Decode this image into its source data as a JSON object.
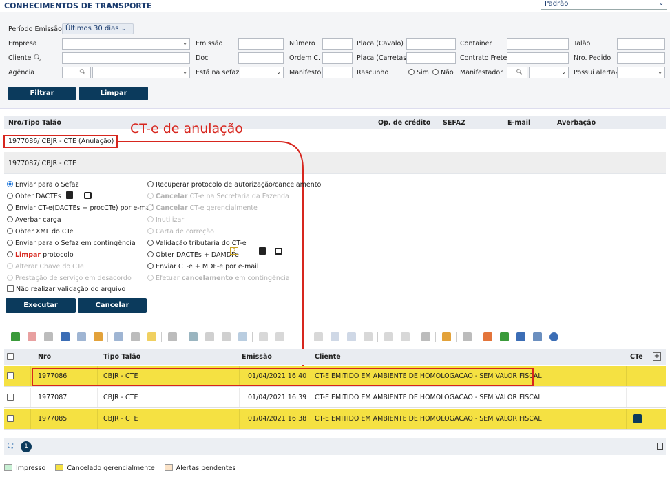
{
  "header": {
    "title": "CONHECIMENTOS DE TRANSPORTE",
    "preset": "Padrão"
  },
  "filters": {
    "periodo_label": "Período Emissão",
    "periodo_value": "Últimos 30 dias",
    "labels": {
      "empresa": "Empresa",
      "emissao": "Emissão",
      "numero": "Número",
      "placa_cavalo": "Placa (Cavalo)",
      "container": "Container",
      "talao": "Talão",
      "cliente": "Cliente",
      "doc": "Doc",
      "ordem": "Ordem C.",
      "placa_carretas": "Placa (Carretas)",
      "contrato": "Contrato Frete",
      "nro_pedido": "Nro. Pedido",
      "agencia": "Agência",
      "sefaz": "Está na sefaz?",
      "manifesto": "Manifesto",
      "rascunho": "Rascunho",
      "sim": "Sim",
      "nao": "Não",
      "manifestador": "Manifestador",
      "alerta": "Possui alerta?"
    },
    "filtrar": "Filtrar",
    "limpar": "Limpar"
  },
  "talao_table": {
    "headers": [
      "Nro/Tipo Talão",
      "Op. de crédito",
      "SEFAZ",
      "E-mail",
      "Averbação"
    ],
    "rows": [
      "1977086/ CBJR - CTE  (Anulação)",
      "1977087/ CBJR - CTE"
    ]
  },
  "annotation": "CT-e de anulação",
  "actions": {
    "left": [
      {
        "label": "Enviar para o Sefaz",
        "state": "selected"
      },
      {
        "label": "Obter DACTEs",
        "state": "normal"
      },
      {
        "label": "Enviar CT-e(DACTEs + procCTe) por e-mail",
        "state": "normal"
      },
      {
        "label": "Averbar carga",
        "state": "normal"
      },
      {
        "label": "Obter XML do CTe",
        "state": "normal"
      },
      {
        "label": "Enviar para o Sefaz em contingência",
        "state": "normal"
      },
      {
        "label_bold": "Limpar",
        "label_rest": " protocolo",
        "state": "normal"
      },
      {
        "label": "Alterar Chave do CTe",
        "state": "disabled"
      },
      {
        "label": "Prestação de serviço em desacordo",
        "state": "disabled"
      }
    ],
    "right": [
      {
        "label": "Recuperar protocolo de autorização/cancelamento",
        "state": "normal"
      },
      {
        "label_bold": "Cancelar",
        "label_rest": " CT-e na Secretaria da Fazenda",
        "state": "disabled"
      },
      {
        "label_bold": "Cancelar",
        "label_rest": " CT-e gerencialmente",
        "state": "disabled"
      },
      {
        "label": "Inutilizar",
        "state": "disabled"
      },
      {
        "label": "Carta de correção",
        "state": "disabled"
      },
      {
        "label": "Validação tributária do CT-e",
        "state": "normal"
      },
      {
        "label": "Obter DACTEs + DAMDFe",
        "state": "normal"
      },
      {
        "label": "Enviar CT-e + MDF-e por e-mail",
        "state": "normal"
      },
      {
        "label_pre": "Efetuar ",
        "label_bold": "cancelamento",
        "label_rest": " em contingência",
        "state": "disabled"
      }
    ],
    "checkbox": "Não realizar validação do arquivo",
    "executar": "Executar",
    "cancelar": "Cancelar"
  },
  "grid": {
    "headers": [
      "Nro",
      "Tipo Talão",
      "Emissão",
      "Cliente",
      "CTe"
    ],
    "rows": [
      {
        "nro": "1977086",
        "tipo": "CBJR - CTE",
        "emissao": "01/04/2021 16:40",
        "cliente": "CT-E EMITIDO EM AMBIENTE DE HOMOLOGACAO - SEM VALOR FISCAL",
        "color": "#f5e142"
      },
      {
        "nro": "1977087",
        "tipo": "CBJR - CTE",
        "emissao": "01/04/2021 16:39",
        "cliente": "CT-E EMITIDO EM AMBIENTE DE HOMOLOGACAO - SEM VALOR FISCAL",
        "color": "#ffffff"
      },
      {
        "nro": "1977085",
        "tipo": "CBJR - CTE",
        "emissao": "01/04/2021 16:38",
        "cliente": "CT-E EMITIDO EM AMBIENTE DE HOMOLOGACAO - SEM VALOR FISCAL",
        "color": "#f5e142"
      }
    ]
  },
  "pager": {
    "page": "1"
  },
  "legend": [
    {
      "label": "Impresso",
      "color": "#c8f0d4"
    },
    {
      "label": "Cancelado gerencialmente",
      "color": "#f5e142"
    },
    {
      "label": "Alertas pendentes",
      "color": "#fbe3c8"
    }
  ]
}
